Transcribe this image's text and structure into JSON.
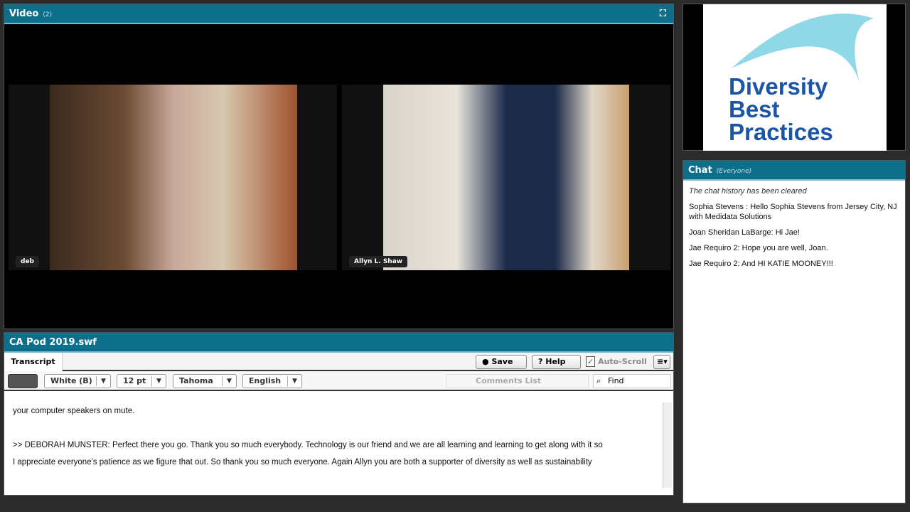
{
  "video": {
    "title": "Video",
    "count": "(2)",
    "participants": [
      {
        "name": "deb"
      },
      {
        "name": "Allyn L. Shaw"
      }
    ]
  },
  "logo": {
    "lines": [
      "Diversity",
      "Best",
      "Practices"
    ]
  },
  "chat": {
    "title": "Chat",
    "scope": "(Everyone)",
    "system": "The chat history has been cleared",
    "messages": [
      {
        "text": "Sophia  Stevens : Hello Sophia Stevens from Jersey City, NJ with Medidata Solutions"
      },
      {
        "text": "Joan Sheridan LaBarge: Hi Jae!"
      },
      {
        "text": "Jae Requiro 2: Hope you are well, Joan."
      },
      {
        "text": "Jae Requiro 2: And HI KATIE MOONEY!!!"
      }
    ]
  },
  "pod": {
    "title": "CA Pod 2019.swf",
    "tab": "Transcript",
    "save": "Save",
    "help": "Help",
    "autoscroll": "Auto-Scroll",
    "color": "White (B)",
    "size": "12 pt",
    "font": "Tahoma",
    "language": "English",
    "comments": "Comments List",
    "find": "Find",
    "lines": [
      "your computer speakers on mute.",
      "",
      ">> DEBORAH MUNSTER: Perfect there you go. Thank you so much everybody. Technology is our friend and we are all learning and learning to get along with it so",
      "I appreciate everyone's patience as we figure that out. So thank you so much everyone. Again Allyn you are both a supporter of diversity as well as sustainability"
    ]
  }
}
